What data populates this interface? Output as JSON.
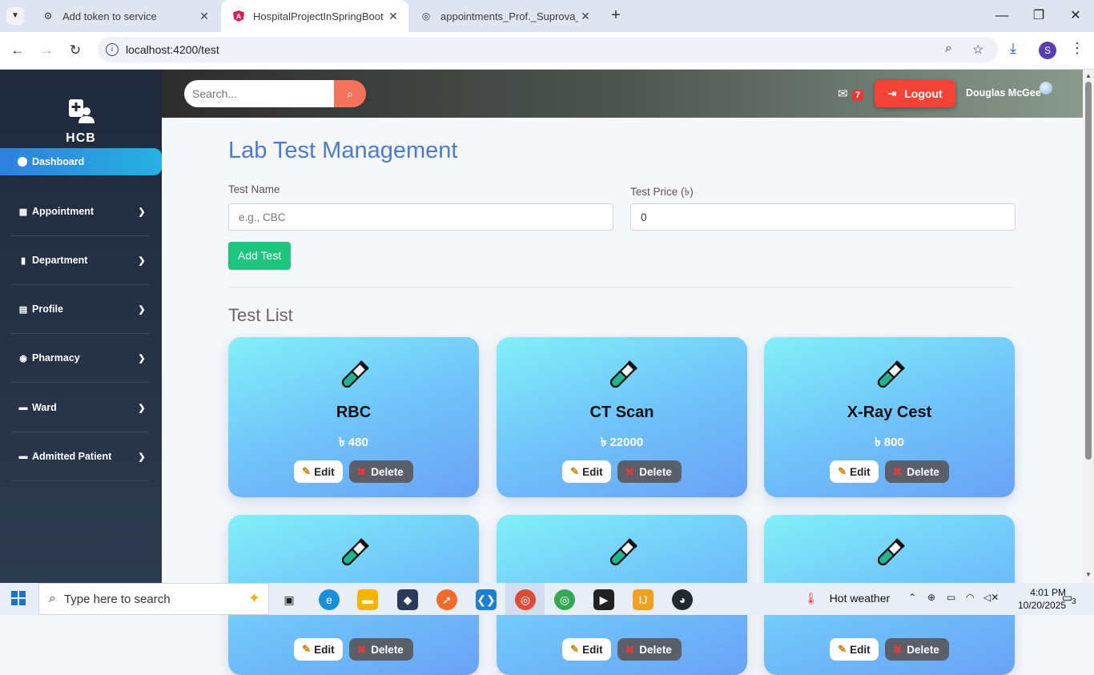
{
  "browser": {
    "tabs": [
      {
        "title": "Add token to service",
        "active": false
      },
      {
        "title": "HospitalProjectInSpringBoot",
        "active": true
      },
      {
        "title": "appointments_Prof._Suprova_Sl",
        "active": false
      }
    ],
    "url": "localhost:4200/test",
    "profile_initial": "S"
  },
  "sidebar": {
    "brand": "HCB",
    "dashboard_label": "Dashboard",
    "items": [
      {
        "label": "Appointment",
        "icon": "calendar-icon"
      },
      {
        "label": "Department",
        "icon": "building-icon"
      },
      {
        "label": "Profile",
        "icon": "id-card-icon"
      },
      {
        "label": "Pharmacy",
        "icon": "pills-icon"
      },
      {
        "label": "Ward",
        "icon": "bed-icon"
      },
      {
        "label": "Admitted Patient",
        "icon": "bed-icon"
      }
    ]
  },
  "topnav": {
    "search_placeholder": "Search...",
    "mail_count": "7",
    "logout_label": "Logout",
    "username": "Douglas McGee"
  },
  "main": {
    "title": "Lab Test Management",
    "test_name_label": "Test Name",
    "test_name_placeholder": "e.g., CBC",
    "test_price_label": "Test Price (৳)",
    "test_price_value": "0",
    "add_button": "Add Test",
    "list_title": "Test List",
    "edit_label": "Edit",
    "delete_label": "Delete",
    "tests": [
      {
        "name": "RBC",
        "price": "৳ 480"
      },
      {
        "name": "CT Scan",
        "price": "৳ 22000"
      },
      {
        "name": "X-Ray Cest",
        "price": "৳ 800"
      },
      {
        "name": "",
        "price": ""
      },
      {
        "name": "",
        "price": ""
      },
      {
        "name": "",
        "price": ""
      }
    ]
  },
  "taskbar": {
    "search_placeholder": "Type here to search",
    "weather": "Hot weather",
    "time": "4:01 PM",
    "date": "10/20/2025",
    "notifications": "3"
  },
  "colors": {
    "accent": "#4a7bd0",
    "success": "#1fc57f",
    "danger": "#f44336",
    "sidebar": "#1f2a3c"
  }
}
